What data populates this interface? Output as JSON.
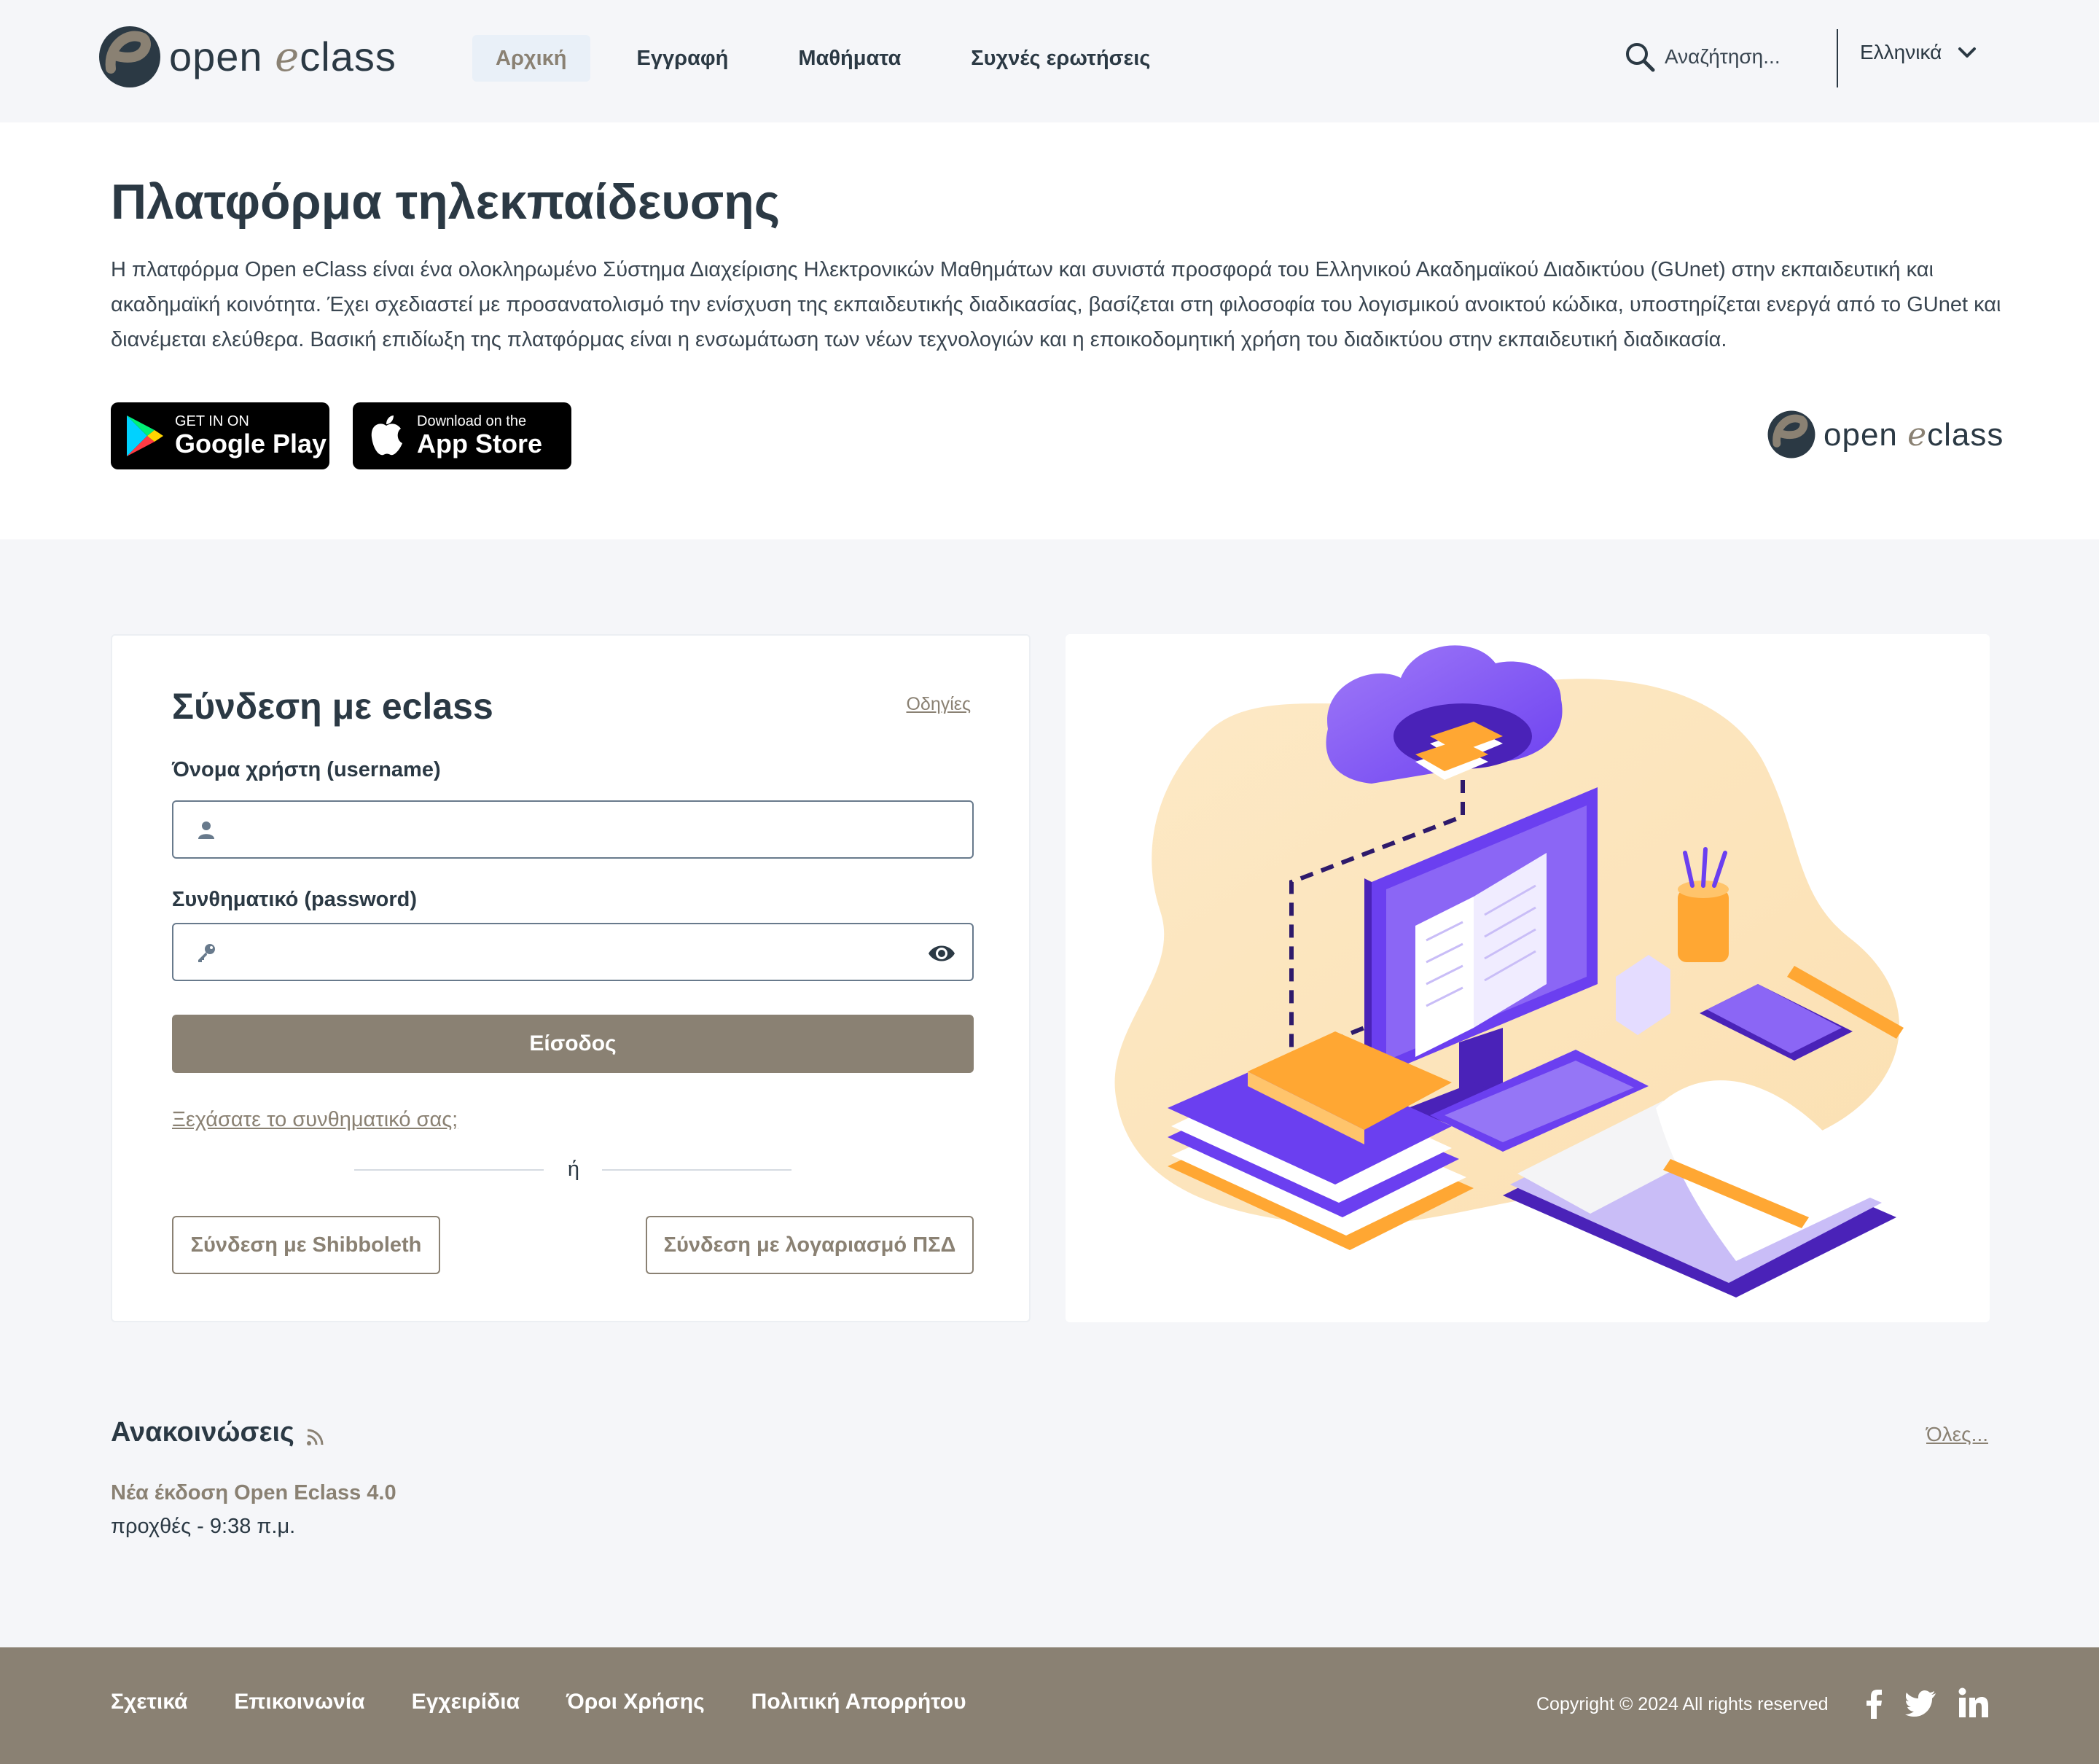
{
  "header": {
    "logo_open": "open ",
    "logo_e": "e",
    "logo_class": "class",
    "nav": [
      {
        "label": "Αρχική",
        "active": true
      },
      {
        "label": "Εγγραφή",
        "active": false
      },
      {
        "label": "Μαθήματα",
        "active": false
      },
      {
        "label": "Συχνές ερωτήσεις",
        "active": false
      }
    ],
    "search_placeholder": "Αναζήτηση...",
    "language": "Ελληνικά",
    "icons": [
      "search-icon",
      "chevron-down-icon"
    ]
  },
  "intro": {
    "title": "Πλατφόρμα τηλεκπαίδευσης",
    "text": "Η πλατφόρμα Open eClass είναι ένα ολοκληρωμένο Σύστημα Διαχείρισης Ηλεκτρονικών Μαθημάτων και συνιστά προσφορά του Ελληνικού Ακαδημαϊκού Διαδικτύου (GUnet) στην εκπαιδευτική και ακαδημαϊκή κοινότητα. Έχει σχεδιαστεί με προσανατολισμό την ενίσχυση της εκπαιδευτικής διαδικασίας, βασίζεται στη φιλοσοφία του λογισμικού ανοικτού κώδικα, υποστηρίζεται ενεργά από το GUnet και διανέμεται ελεύθερα. Βασική επιδίωξη της πλατφόρμας είναι η ενσωμάτωση των νέων τεχνολογιών και η εποικοδομητική χρήση του διαδικτύου στην εκπαιδευτική διαδικασία.",
    "google_play": {
      "small": "GET IN ON",
      "big": "Google Play"
    },
    "app_store": {
      "small": "Download on the",
      "big": "App Store"
    }
  },
  "login": {
    "title": "Σύνδεση με eclass",
    "guides": "Οδηγίες",
    "username_label": "Όνομα χρήστη (username)",
    "username_value": "",
    "password_label": "Συνθηματικό (password)",
    "password_value": "",
    "submit": "Είσοδος",
    "forgot": "Ξεχάσατε το συνθηματικό σας;",
    "or": "ή",
    "shibboleth": "Σύνδεση με Shibboleth",
    "psd": "Σύνδεση με λογαριασμό ΠΣΔ"
  },
  "announcements": {
    "title": "Ανακοινώσεις",
    "all": "Όλες...",
    "items": [
      {
        "title": "Νέα έκδοση Open Eclass 4.0",
        "date": "προχθές - 9:38 π.μ."
      }
    ]
  },
  "footer": {
    "links": [
      "Σχετικά",
      "Επικοινωνία",
      "Εγχειρίδια",
      "Όροι Χρήσης",
      "Πολιτική Απορρήτου"
    ],
    "copyright": "Copyright © 2024 All rights reserved",
    "social": [
      "facebook-icon",
      "twitter-icon",
      "linkedin-icon"
    ]
  },
  "colors": {
    "accent": "#8a8173",
    "text": "#2b3944",
    "header_bg": "#f5f6f9",
    "nav_active_bg": "#e9f0f8",
    "illustration_purple": "#6b3ff0",
    "illustration_orange": "#ffa733"
  }
}
